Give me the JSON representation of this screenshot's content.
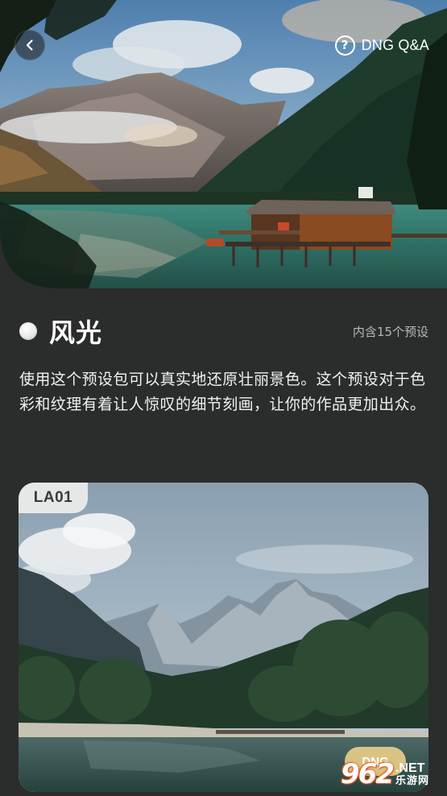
{
  "header": {
    "back_icon": "chevron-left-icon",
    "qa_icon": "question-circle-icon",
    "qa_label": "DNG Q&A"
  },
  "section": {
    "title": "风光",
    "preset_count": "内含15个预设",
    "description": "使用这个预设包可以真实地还原壮丽景色。这个预设对于色彩和纹理有着让人惊叹的细节刻画，让你的作品更加出众。"
  },
  "preview": {
    "tag": "LA01",
    "badge": "DNG"
  },
  "watermark": {
    "logo": "962",
    "net": ".NET",
    "site": "乐游网"
  },
  "colors": {
    "background": "#2b2c2c",
    "text": "#ffffff",
    "muted_text": "#b8b8b8",
    "tag_bg": "#eeeeec"
  }
}
